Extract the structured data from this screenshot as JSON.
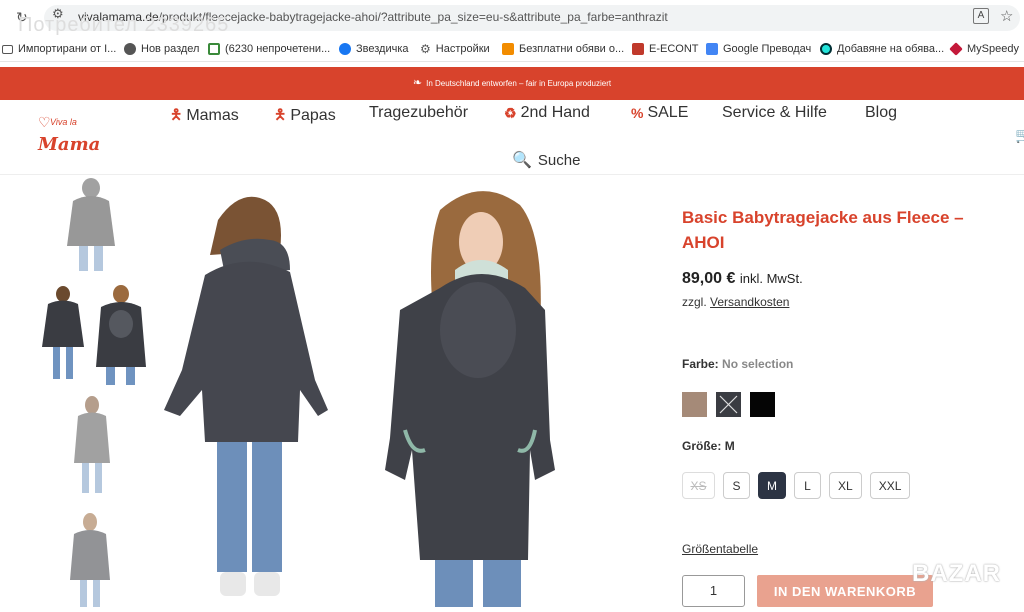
{
  "browser": {
    "url_host": "vivalamama.de",
    "url_path": "/produkt/fleecejacke-babytragejacke-ahoi/?attribute_pa_size=eu-s&attribute_pa_farbe=anthrazit",
    "overlay_text": "Потребител 2339265",
    "bookmarks": [
      {
        "label": "Импортирани от I...",
        "icon": "folder-icon"
      },
      {
        "label": "Нов раздел",
        "icon": "globe-icon"
      },
      {
        "label": "(6230 непрочетени...",
        "icon": "home-icon"
      },
      {
        "label": "Звездичка",
        "icon": "facebook-icon"
      },
      {
        "label": "Настройки",
        "icon": "gear-icon"
      },
      {
        "label": "Безплатни обяви о...",
        "icon": "bag-icon"
      },
      {
        "label": "E-ECONT",
        "icon": "econt-icon"
      },
      {
        "label": "Google Преводач",
        "icon": "translate-icon"
      },
      {
        "label": "Добавяне на обява...",
        "icon": "olx-icon"
      },
      {
        "label": "MySpeedy",
        "icon": "cube-icon"
      }
    ]
  },
  "promo": {
    "text": "In Deutschland entworfen – fair in Europa produziert"
  },
  "site": {
    "logo_small": "Viva la",
    "logo_big": "Mama",
    "nav": [
      {
        "label": "Mamas",
        "icon": "person-icon"
      },
      {
        "label": "Papas",
        "icon": "person-icon"
      },
      {
        "label": "Tragezubehör",
        "icon": ""
      },
      {
        "label": "2nd Hand",
        "icon": "recycle-icon"
      },
      {
        "label": "SALE",
        "icon": "percent-icon"
      },
      {
        "label": "Service & Hilfe",
        "icon": ""
      },
      {
        "label": "Blog",
        "icon": ""
      }
    ],
    "search_label": "Suche"
  },
  "product": {
    "title": "Basic Babytragejacke aus Fleece – AHOI",
    "price": "89,00 €",
    "tax": "inkl. MwSt.",
    "shipping_prefix": "zzgl.",
    "shipping_link": "Versandkosten",
    "color_label": "Farbe:",
    "color_value": "No selection",
    "colors": [
      {
        "name": "beige",
        "hex": "#a58a78"
      },
      {
        "name": "anthrazit",
        "hex": "#3a3c42"
      },
      {
        "name": "schwarz",
        "hex": "#050505"
      }
    ],
    "size_label": "Größe:",
    "size_value": "M",
    "sizes": [
      "XS",
      "S",
      "M",
      "L",
      "XL",
      "XXL"
    ],
    "size_table_link": "Größentabelle",
    "quantity": "1",
    "add_to_cart": "IN DEN WARENKORB"
  },
  "colors": {
    "brand": "#d8432c",
    "brand_light": "#e9a28f",
    "selected_size": "#2c3444"
  },
  "watermark": "BAZAR"
}
